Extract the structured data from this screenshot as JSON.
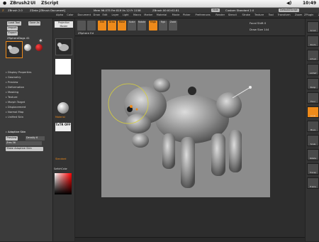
{
  "menubar": {
    "app": "ZBrush2",
    "items": [
      "UI",
      "ZScript"
    ],
    "clock": "10:49"
  },
  "zbtitle": {
    "app_version": "ZBrush 2.0",
    "document": "ZData [ZBrush Document]",
    "stats": "Mem 96.075 Fre 819 Vs 12 Fr 1158",
    "zbrush_time": "ZBrush 00:00:02.81",
    "hide": "Hide",
    "material": "Custom Standard 2.0",
    "default_script": "DefaultZScript"
  },
  "menus": [
    "Alpha",
    "Color",
    "Document",
    "Draw",
    "Edit",
    "Layer",
    "Light",
    "Macro",
    "Marker",
    "Material",
    "Movie",
    "Picker",
    "Preferences",
    "Render",
    "Stencil",
    "Stroke",
    "Texture",
    "Tool",
    "Transform",
    "Zoom",
    "ZPlugin",
    "ZScript"
  ],
  "left": {
    "load": "Load Tool",
    "save_as": "Save As",
    "import": "Import",
    "export": "Export",
    "tool_name": "ZSphereDogs 41",
    "items": [
      "Display Properties",
      "Geometry",
      "Preview",
      "Deformation",
      "Masking",
      "Texture",
      "Morph Target",
      "Displacement",
      "Normal Map",
      "Unified Skin"
    ],
    "adaptive": "Adaptive Skin",
    "preview_btn": "Preview",
    "ires_label": "Density 6",
    "res_row": "Zres 56",
    "make_btn": "Make Adaptive Skin"
  },
  "shelf": {
    "projection": "Projection Master",
    "material_name": "Material",
    "txtr": "TxTR OFF",
    "standard": "Standard",
    "colorPicker": "SwitchColor"
  },
  "top": {
    "edit": "Edit",
    "move": "Move",
    "scale": "Scale",
    "rotate": "Rotate",
    "mrgb": "Mrgb",
    "rgb": "Rgb",
    "zadd": "Zadd",
    "zsub": "Zsub",
    "zsub_label": "ZSphere Ed",
    "edit_label": "Edit",
    "draw": "Draw",
    "focal_label": "Focal Shift 0",
    "draw_size": "Draw Size 144"
  },
  "right": [
    "Scroll",
    "Zoom",
    "Actual",
    "AAHalf",
    "Persp",
    "Floor",
    "Local",
    "Move",
    "Scale",
    "Rotate",
    "Transp",
    "Frame"
  ],
  "colors": {
    "accent": "#ee8a1a",
    "panel": "#3b3b3b",
    "canvas": "#8c8c8c"
  }
}
